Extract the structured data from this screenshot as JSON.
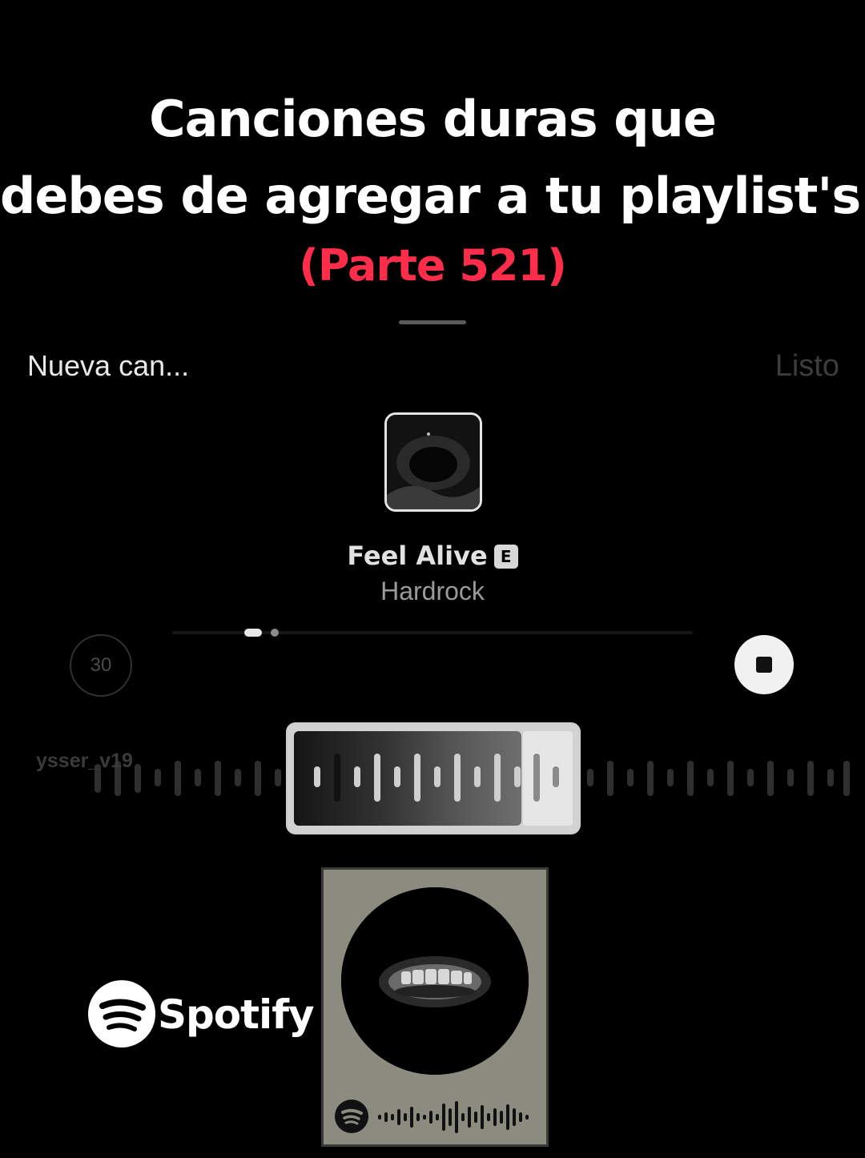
{
  "overlay": {
    "title_line1": "Canciones duras que",
    "title_line2": "debes de agregar a tu playlist's:",
    "part_label": "(Parte 521)",
    "part_color": "#ff2d4a"
  },
  "header": {
    "left_label": "Nueva can...",
    "done_label": "Listo"
  },
  "song": {
    "title": "Feel Alive",
    "explicit_badge": "E",
    "artist": "Hardrock"
  },
  "player": {
    "duration_seconds": "30",
    "stop_icon": "stop-icon",
    "progress_fraction": 0.15
  },
  "watermark": {
    "handle": "ysser_v19"
  },
  "branding": {
    "spotify_wordmark": "Spotify",
    "spotify_icon": "spotify-logo-icon"
  }
}
